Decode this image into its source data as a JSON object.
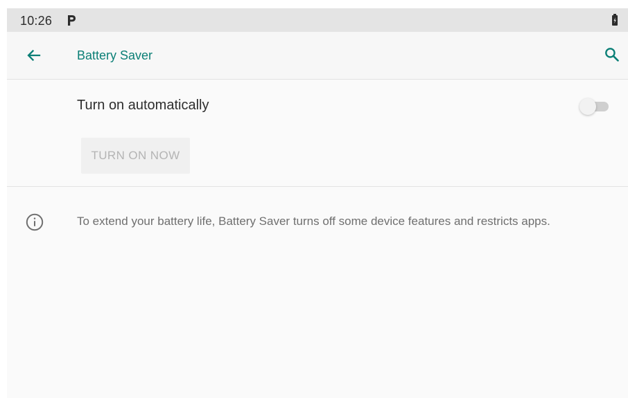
{
  "status_bar": {
    "time": "10:26",
    "left_indicator_icon": "parking-icon",
    "right_indicator_icon": "battery-icon"
  },
  "app_bar": {
    "title": "Battery Saver",
    "back_icon": "back-arrow-icon",
    "search_icon": "search-icon",
    "accent_color": "#0b7f76"
  },
  "settings": {
    "auto_label": "Turn on automatically",
    "auto_toggle": {
      "state": "off"
    },
    "turn_on_now_label": "TURN ON NOW"
  },
  "info": {
    "icon": "info-icon",
    "text": "To extend your battery life, Battery Saver turns off some device features and restricts apps."
  },
  "colors": {
    "status_bar_bg": "#e4e4e4",
    "surface_bg": "#fafafa",
    "text_primary": "#2d2d2d",
    "text_secondary": "#6f6f6f",
    "disabled_text": "#b4b4b4"
  }
}
